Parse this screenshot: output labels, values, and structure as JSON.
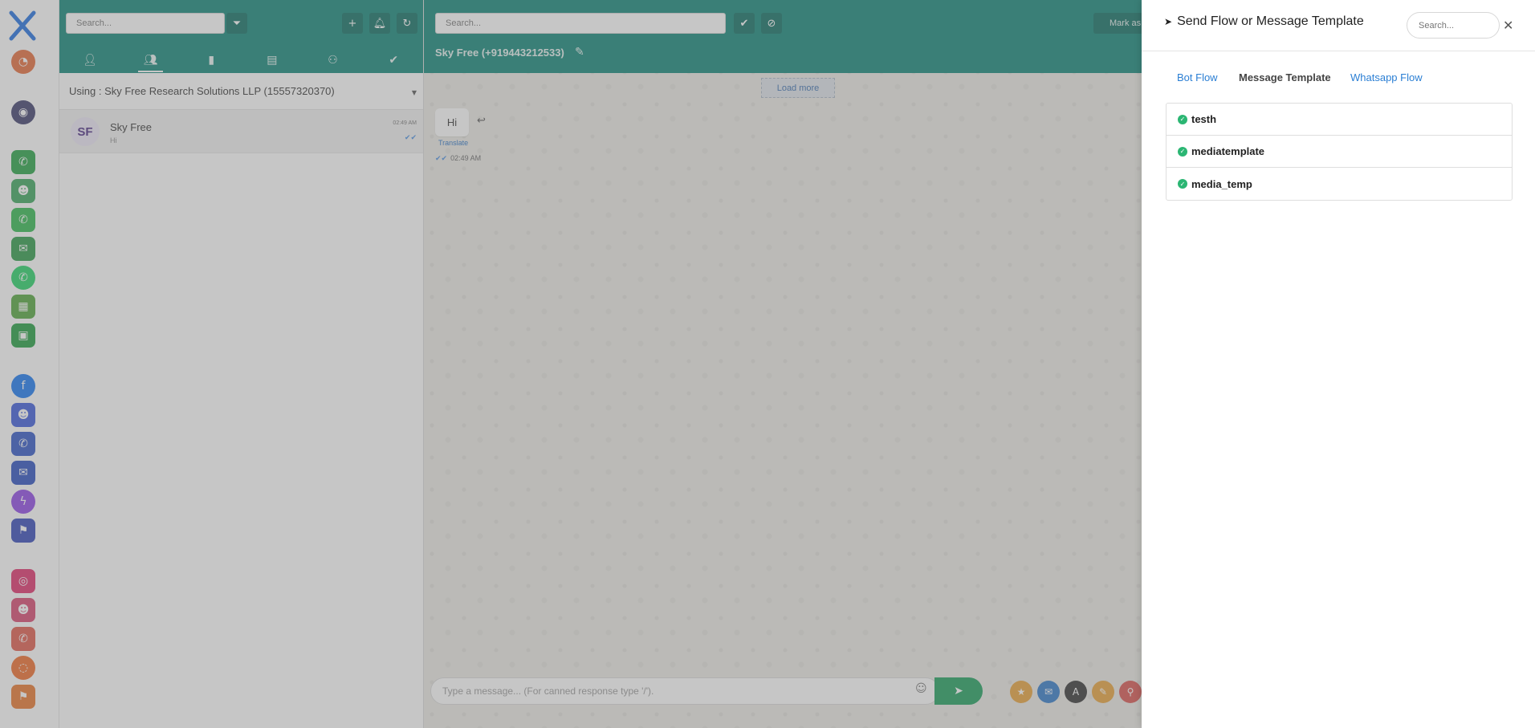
{
  "rail": {
    "logo_color": "#1f6fe0",
    "apps": [
      {
        "name": "dashboard-app-icon",
        "glyph": "◔",
        "color": "#e66b3a",
        "round": true
      },
      {
        "name": "chat-support-app-icon",
        "glyph": "◉",
        "color": "#3d3d6b",
        "round": true
      },
      {
        "name": "whatsapp-business-app-icon",
        "glyph": "✆",
        "color": "#25a244",
        "round": false
      },
      {
        "name": "whatsapp-bot-app-icon",
        "glyph": "☻",
        "color": "#3aa55c",
        "round": false
      },
      {
        "name": "whatsapp-calls-app-icon",
        "glyph": "✆",
        "color": "#2fb84f",
        "round": false
      },
      {
        "name": "whatsapp-broadcast-app-icon",
        "glyph": "✉",
        "color": "#2b9a48",
        "round": false
      },
      {
        "name": "whatsapp-app-icon",
        "glyph": "✆",
        "color": "#25d366",
        "round": true
      },
      {
        "name": "whatsapp-catalog-app-icon",
        "glyph": "▦",
        "color": "#52a63c",
        "round": false
      },
      {
        "name": "whatsapp-shop-app-icon",
        "glyph": "▣",
        "color": "#1f9d3e",
        "round": false
      },
      {
        "name": "facebook-app-icon",
        "glyph": "f",
        "color": "#1877f2",
        "round": true
      },
      {
        "name": "messenger-bot-app-icon",
        "glyph": "☻",
        "color": "#3b5bdb",
        "round": false
      },
      {
        "name": "messenger-calls-app-icon",
        "glyph": "✆",
        "color": "#2f55c7",
        "round": false
      },
      {
        "name": "messenger-broadcast-app-icon",
        "glyph": "✉",
        "color": "#2a4fc0",
        "round": false
      },
      {
        "name": "messenger-app-icon",
        "glyph": "ϟ",
        "color": "#8e45e6",
        "round": true
      },
      {
        "name": "messenger-flow-app-icon",
        "glyph": "⚑",
        "color": "#3248b8",
        "round": false
      },
      {
        "name": "instagram-app-icon",
        "glyph": "◎",
        "color": "#e1306c",
        "round": false
      },
      {
        "name": "instagram-bot-app-icon",
        "glyph": "☻",
        "color": "#d7456e",
        "round": false
      },
      {
        "name": "instagram-calls-app-icon",
        "glyph": "✆",
        "color": "#e05a4a",
        "round": false
      },
      {
        "name": "instagram-comments-app-icon",
        "glyph": "◌",
        "color": "#ef6c2a",
        "round": true
      },
      {
        "name": "instagram-flow-app-icon",
        "glyph": "⚑",
        "color": "#e8752c",
        "round": false
      }
    ]
  },
  "list": {
    "search_placeholder": "Search...",
    "using_label": "Using : Sky Free Research Solutions LLP (15557320370)",
    "conversations": [
      {
        "initials": "SF",
        "name": "Sky Free",
        "last_message": "Hi",
        "time": "02:49 AM"
      }
    ]
  },
  "chat": {
    "search_placeholder": "Search...",
    "title": "Sky Free (+919443212533)",
    "mark_label": "Mark as",
    "load_more": "Load more",
    "message_text": "Hi",
    "translate_label": "Translate",
    "message_time": "02:49 AM",
    "composer_placeholder": "Type a message... (For canned response type '/')."
  },
  "drawer": {
    "title": "Send Flow or Message Template",
    "search_placeholder": "Search...",
    "tabs": [
      {
        "label": "Bot Flow",
        "active": false
      },
      {
        "label": "Message Template",
        "active": true
      },
      {
        "label": "Whatsapp Flow",
        "active": false
      }
    ],
    "templates": [
      "testh",
      "mediatemplate",
      "media_temp"
    ]
  },
  "colors": {
    "header_teal": "#0f8577",
    "send_green": "#1c9f5c",
    "link_blue": "#2b7fd4",
    "approved_green": "#2bb673"
  }
}
